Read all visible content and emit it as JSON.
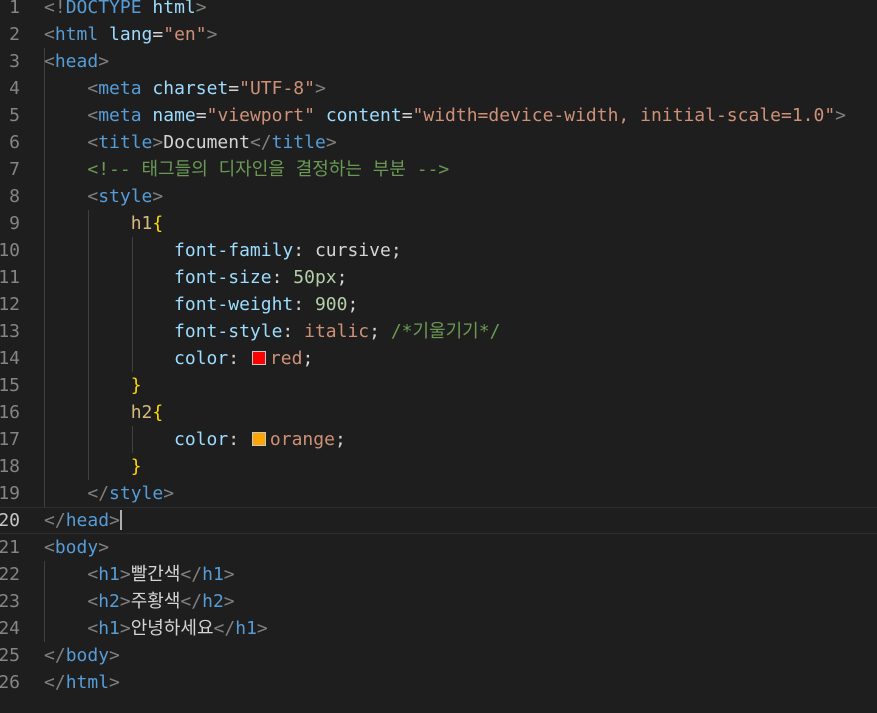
{
  "editor": {
    "current_line": 20,
    "lines": [
      {
        "n": "1",
        "tokens": [
          [
            "bracket",
            "<!"
          ],
          [
            "doctype",
            "DOCTYPE "
          ],
          [
            "attr",
            "html"
          ],
          [
            "bracket",
            ">"
          ]
        ]
      },
      {
        "n": "2",
        "tokens": [
          [
            "bracket",
            "<"
          ],
          [
            "tag",
            "html"
          ],
          [
            "text",
            " "
          ],
          [
            "attr",
            "lang"
          ],
          [
            "punc",
            "="
          ],
          [
            "str",
            "\"en\""
          ],
          [
            "bracket",
            ">"
          ]
        ]
      },
      {
        "n": "3",
        "tokens": [
          [
            "bracket",
            "<"
          ],
          [
            "tag",
            "head"
          ],
          [
            "bracket",
            ">"
          ]
        ]
      },
      {
        "n": "4",
        "tokens": [
          [
            "text",
            "    "
          ],
          [
            "bracket",
            "<"
          ],
          [
            "tag",
            "meta"
          ],
          [
            "text",
            " "
          ],
          [
            "attr",
            "charset"
          ],
          [
            "punc",
            "="
          ],
          [
            "str",
            "\"UTF-8\""
          ],
          [
            "bracket",
            ">"
          ]
        ]
      },
      {
        "n": "5",
        "tokens": [
          [
            "text",
            "    "
          ],
          [
            "bracket",
            "<"
          ],
          [
            "tag",
            "meta"
          ],
          [
            "text",
            " "
          ],
          [
            "attr",
            "name"
          ],
          [
            "punc",
            "="
          ],
          [
            "str",
            "\"viewport\""
          ],
          [
            "text",
            " "
          ],
          [
            "attr",
            "content"
          ],
          [
            "punc",
            "="
          ],
          [
            "str",
            "\"width=device-width, initial-scale=1.0\""
          ],
          [
            "bracket",
            ">"
          ]
        ]
      },
      {
        "n": "6",
        "tokens": [
          [
            "text",
            "    "
          ],
          [
            "bracket",
            "<"
          ],
          [
            "tag",
            "title"
          ],
          [
            "bracket",
            ">"
          ],
          [
            "text",
            "Document"
          ],
          [
            "bracket",
            "</"
          ],
          [
            "tag",
            "title"
          ],
          [
            "bracket",
            ">"
          ]
        ]
      },
      {
        "n": "7",
        "tokens": [
          [
            "text",
            "    "
          ],
          [
            "comment",
            "<!-- 태그들의 디자인을 결정하는 부분 -->"
          ]
        ]
      },
      {
        "n": "8",
        "tokens": [
          [
            "text",
            "    "
          ],
          [
            "bracket",
            "<"
          ],
          [
            "tag",
            "style"
          ],
          [
            "bracket",
            ">"
          ]
        ]
      },
      {
        "n": "9",
        "tokens": [
          [
            "text",
            "        "
          ],
          [
            "sel",
            "h1"
          ],
          [
            "brace",
            "{"
          ]
        ]
      },
      {
        "n": "10",
        "tokens": [
          [
            "text",
            "            "
          ],
          [
            "prop",
            "font-family"
          ],
          [
            "punc",
            ": "
          ],
          [
            "text",
            "cursive"
          ],
          [
            "punc",
            ";"
          ]
        ]
      },
      {
        "n": "11",
        "tokens": [
          [
            "text",
            "            "
          ],
          [
            "prop",
            "font-size"
          ],
          [
            "punc",
            ": "
          ],
          [
            "num",
            "50px"
          ],
          [
            "punc",
            ";"
          ]
        ]
      },
      {
        "n": "12",
        "tokens": [
          [
            "text",
            "            "
          ],
          [
            "prop",
            "font-weight"
          ],
          [
            "punc",
            ": "
          ],
          [
            "num",
            "900"
          ],
          [
            "punc",
            ";"
          ]
        ]
      },
      {
        "n": "13",
        "tokens": [
          [
            "text",
            "            "
          ],
          [
            "prop",
            "font-style"
          ],
          [
            "punc",
            ": "
          ],
          [
            "val",
            "italic"
          ],
          [
            "punc",
            "; "
          ],
          [
            "comment",
            "/*기울기기*/"
          ]
        ]
      },
      {
        "n": "14",
        "tokens": [
          [
            "text",
            "            "
          ],
          [
            "prop",
            "color"
          ],
          [
            "punc",
            ": "
          ],
          [
            "swatch",
            "#ff0000"
          ],
          [
            "val",
            "red"
          ],
          [
            "punc",
            ";"
          ]
        ]
      },
      {
        "n": "15",
        "tokens": [
          [
            "text",
            "        "
          ],
          [
            "brace",
            "}"
          ]
        ]
      },
      {
        "n": "16",
        "tokens": [
          [
            "text",
            "        "
          ],
          [
            "sel",
            "h2"
          ],
          [
            "brace",
            "{"
          ]
        ]
      },
      {
        "n": "17",
        "tokens": [
          [
            "text",
            "            "
          ],
          [
            "prop",
            "color"
          ],
          [
            "punc",
            ": "
          ],
          [
            "swatch",
            "#ffa500"
          ],
          [
            "val",
            "orange"
          ],
          [
            "punc",
            ";"
          ]
        ]
      },
      {
        "n": "18",
        "tokens": [
          [
            "text",
            "        "
          ],
          [
            "brace",
            "}"
          ]
        ]
      },
      {
        "n": "19",
        "tokens": [
          [
            "text",
            "    "
          ],
          [
            "bracket",
            "</"
          ],
          [
            "tag",
            "style"
          ],
          [
            "bracket",
            ">"
          ]
        ]
      },
      {
        "n": "20",
        "tokens": [
          [
            "bracket",
            "</"
          ],
          [
            "tag",
            "head"
          ],
          [
            "bracket",
            ">"
          ],
          [
            "cursor",
            ""
          ]
        ]
      },
      {
        "n": "21",
        "tokens": [
          [
            "bracket",
            "<"
          ],
          [
            "tag",
            "body"
          ],
          [
            "bracket",
            ">"
          ]
        ]
      },
      {
        "n": "22",
        "tokens": [
          [
            "text",
            "    "
          ],
          [
            "bracket",
            "<"
          ],
          [
            "tag",
            "h1"
          ],
          [
            "bracket",
            ">"
          ],
          [
            "text",
            "빨간색"
          ],
          [
            "bracket",
            "</"
          ],
          [
            "tag",
            "h1"
          ],
          [
            "bracket",
            ">"
          ]
        ]
      },
      {
        "n": "23",
        "tokens": [
          [
            "text",
            "    "
          ],
          [
            "bracket",
            "<"
          ],
          [
            "tag",
            "h2"
          ],
          [
            "bracket",
            ">"
          ],
          [
            "text",
            "주황색"
          ],
          [
            "bracket",
            "</"
          ],
          [
            "tag",
            "h2"
          ],
          [
            "bracket",
            ">"
          ]
        ]
      },
      {
        "n": "24",
        "tokens": [
          [
            "text",
            "    "
          ],
          [
            "bracket",
            "<"
          ],
          [
            "tag",
            "h1"
          ],
          [
            "bracket",
            ">"
          ],
          [
            "text",
            "안녕하세요"
          ],
          [
            "bracket",
            "</"
          ],
          [
            "tag",
            "h1"
          ],
          [
            "bracket",
            ">"
          ]
        ]
      },
      {
        "n": "25",
        "tokens": [
          [
            "bracket",
            "</"
          ],
          [
            "tag",
            "body"
          ],
          [
            "bracket",
            ">"
          ]
        ]
      },
      {
        "n": "26",
        "tokens": [
          [
            "bracket",
            "</"
          ],
          [
            "tag",
            "html"
          ],
          [
            "bracket",
            ">"
          ]
        ]
      }
    ]
  }
}
